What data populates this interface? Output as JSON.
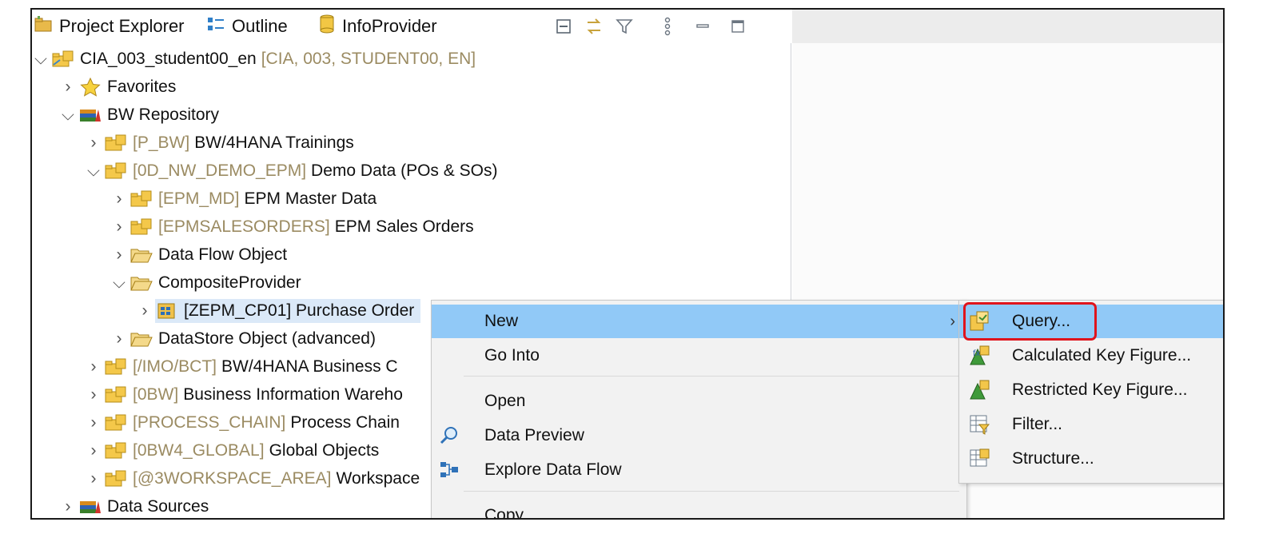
{
  "tabs": [
    {
      "label": "Project Explorer",
      "icon": "project-explorer-icon"
    },
    {
      "label": "Outline",
      "icon": "outline-icon"
    },
    {
      "label": "InfoProvider",
      "icon": "infoprovider-icon"
    }
  ],
  "toolbar_icons": [
    "collapse-all-icon",
    "link-with-editor-icon",
    "filter-icon",
    "view-menu-icon",
    "minimize-icon",
    "maximize-icon"
  ],
  "tree": {
    "project": {
      "name": "CIA_003_student00_en",
      "tech": "[CIA, 003, STUDENT00, EN]"
    },
    "favorites": "Favorites",
    "bw_repository": "BW Repository",
    "p_bw": {
      "tech": "[P_BW]",
      "name": "BW/4HANA Trainings"
    },
    "demo": {
      "tech": "[0D_NW_DEMO_EPM]",
      "name": "Demo Data (POs & SOs)"
    },
    "epm_md": {
      "tech": "[EPM_MD]",
      "name": "EPM Master Data"
    },
    "epm_so": {
      "tech": "[EPMSALESORDERS]",
      "name": "EPM Sales Orders"
    },
    "data_flow": "Data Flow Object",
    "composite": "CompositeProvider",
    "zepm": "[ZEPM_CP01] Purchase Order",
    "dso": "DataStore Object (advanced)",
    "imo": {
      "tech": "[/IMO/BCT]",
      "name": "BW/4HANA Business C"
    },
    "obw": {
      "tech": "[0BW]",
      "name": "Business Information Wareho"
    },
    "process": {
      "tech": "[PROCESS_CHAIN]",
      "name": "Process Chain"
    },
    "global": {
      "tech": "[0BW4_GLOBAL]",
      "name": "Global Objects"
    },
    "workspace": {
      "tech": "[@3WORKSPACE_AREA]",
      "name": "Workspace"
    },
    "data_sources": "Data Sources"
  },
  "context_menu": {
    "new": "New",
    "go_into": "Go Into",
    "open": "Open",
    "data_preview": "Data Preview",
    "explore": "Explore Data Flow",
    "copy": "Copy..."
  },
  "submenu": {
    "query": "Query...",
    "ckf": "Calculated Key Figure...",
    "rkf": "Restricted Key Figure...",
    "filter": "Filter...",
    "structure": "Structure..."
  },
  "colors": {
    "highlight": "#91c9f7",
    "callout": "#e0141c",
    "tech_text": "#9b8b62"
  }
}
